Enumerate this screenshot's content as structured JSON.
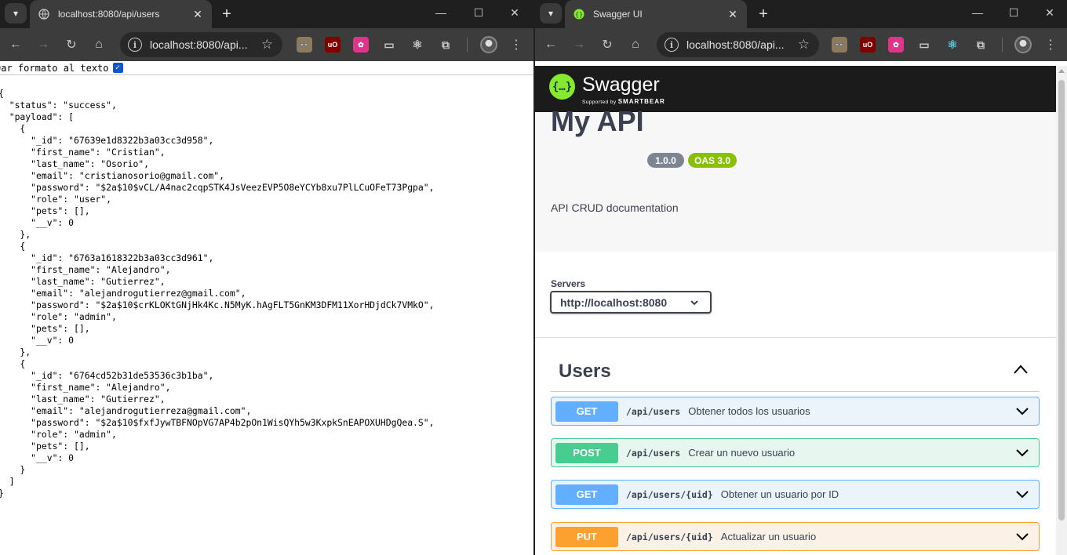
{
  "left_window": {
    "tab_title": "localhost:8080/api/users",
    "url": "localhost:8080/api...",
    "pretty_print_label": "Dar formato al texto",
    "pretty_print_checked": true,
    "json_lines": [
      "{",
      "  \"status\": \"success\",",
      "  \"payload\": [",
      "    {",
      "      \"_id\": \"67639e1d8322b3a03cc3d958\",",
      "      \"first_name\": \"Cristian\",",
      "      \"last_name\": \"Osorio\",",
      "      \"email\": \"cristianosorio@gmail.com\",",
      "      \"password\": \"$2a$10$vCL/A4nac2cqpSTK4JsVeezEVP5O8eYCYb8xu7PlLCuOFeT73Pgpa\",",
      "      \"role\": \"user\",",
      "      \"pets\": [],",
      "      \"__v\": 0",
      "    },",
      "    {",
      "      \"_id\": \"6763a1618322b3a03cc3d961\",",
      "      \"first_name\": \"Alejandro\",",
      "      \"last_name\": \"Gutierrez\",",
      "      \"email\": \"alejandrogutierrez@gmail.com\",",
      "      \"password\": \"$2a$10$crKLOKtGNjHk4Kc.N5MyK.hAgFLT5GnKM3DFM11XorHDjdCk7VMkO\",",
      "      \"role\": \"admin\",",
      "      \"pets\": [],",
      "      \"__v\": 0",
      "    },",
      "    {",
      "      \"_id\": \"6764cd52b31de53536c3b1ba\",",
      "      \"first_name\": \"Alejandro\",",
      "      \"last_name\": \"Gutierrez\",",
      "      \"email\": \"alejandrogutierreza@gmail.com\",",
      "      \"password\": \"$2a$10$fxfJywTBFNOpVG7AP4b2pOn1WisQYh5w3KxpkSnEAPOXUHDgQea.S\",",
      "      \"role\": \"admin\",",
      "      \"pets\": [],",
      "      \"__v\": 0",
      "    }",
      "  ]",
      "}"
    ]
  },
  "right_window": {
    "tab_title": "Swagger UI",
    "url": "localhost:8080/api...",
    "swagger": {
      "logo_glyph": "{…}",
      "brand": "Swagger",
      "supported_by": "Supported by",
      "smartbear": "SMARTBEAR"
    },
    "api_title": "My API",
    "version_badge": "1.0.0",
    "oas_badge": "OAS 3.0",
    "description": "API CRUD documentation",
    "servers_label": "Servers",
    "server_selected": "http://localhost:8080",
    "tag": "Users",
    "operations": [
      {
        "method": "GET",
        "path": "/api/users",
        "summary": "Obtener todos los usuarios"
      },
      {
        "method": "POST",
        "path": "/api/users",
        "summary": "Crear un nuevo usuario"
      },
      {
        "method": "GET",
        "path": "/api/users/{uid}",
        "summary": "Obtener un usuario por ID"
      },
      {
        "method": "PUT",
        "path": "/api/users/{uid}",
        "summary": "Actualizar un usuario"
      }
    ]
  },
  "colors": {
    "get": "#61affe",
    "get_bg": "#ebf3fb",
    "post": "#49cc90",
    "post_bg": "#e8f6f0",
    "put": "#fca130",
    "put_bg": "#fbf1e6",
    "version_badge": "#7d8492",
    "oas_badge": "#89bf04"
  },
  "icons": {
    "extensions": [
      "eyes-extension-icon",
      "ublock-icon",
      "pink-extension-icon",
      "cast-icon",
      "react-devtools-icon",
      "puzzle-extensions-icon"
    ]
  }
}
